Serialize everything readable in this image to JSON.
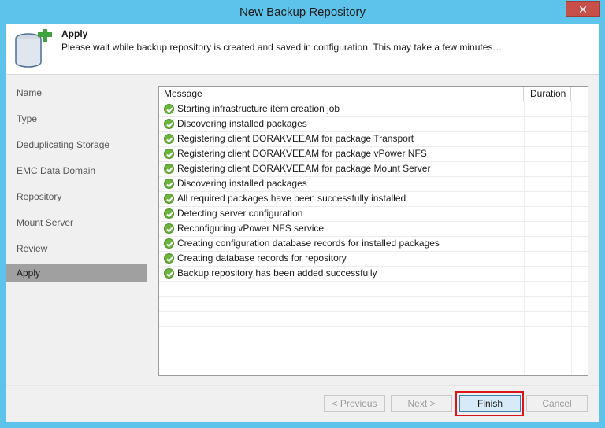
{
  "window": {
    "title": "New Backup Repository",
    "close_label": "✕"
  },
  "header": {
    "title": "Apply",
    "description": "Please wait while backup repository is created and saved in configuration. This may take a few minutes…",
    "icon": "database-add-icon"
  },
  "sidebar": {
    "items": [
      {
        "label": "Name",
        "active": false
      },
      {
        "label": "Type",
        "active": false
      },
      {
        "label": "Deduplicating Storage",
        "active": false
      },
      {
        "label": "EMC Data Domain",
        "active": false
      },
      {
        "label": "Repository",
        "active": false
      },
      {
        "label": "Mount Server",
        "active": false
      },
      {
        "label": "Review",
        "active": false
      },
      {
        "label": "Apply",
        "active": true
      }
    ]
  },
  "log": {
    "columns": [
      "Message",
      "Duration"
    ],
    "rows": [
      {
        "status": "success",
        "message": "Starting infrastructure item creation job",
        "duration": ""
      },
      {
        "status": "success",
        "message": "Discovering installed packages",
        "duration": ""
      },
      {
        "status": "success",
        "message": "Registering client DORAKVEEAM for package Transport",
        "duration": ""
      },
      {
        "status": "success",
        "message": "Registering client DORAKVEEAM for package vPower NFS",
        "duration": ""
      },
      {
        "status": "success",
        "message": "Registering client DORAKVEEAM for package Mount Server",
        "duration": ""
      },
      {
        "status": "success",
        "message": "Discovering installed packages",
        "duration": ""
      },
      {
        "status": "success",
        "message": "All required packages have been successfully installed",
        "duration": ""
      },
      {
        "status": "success",
        "message": "Detecting server configuration",
        "duration": ""
      },
      {
        "status": "success",
        "message": "Reconfiguring vPower NFS service",
        "duration": ""
      },
      {
        "status": "success",
        "message": "Creating configuration database records for installed packages",
        "duration": ""
      },
      {
        "status": "success",
        "message": "Creating database records for repository",
        "duration": ""
      },
      {
        "status": "success",
        "message": "Backup repository has been added successfully",
        "duration": ""
      }
    ]
  },
  "footer": {
    "previous_label": "< Previous",
    "next_label": "Next >",
    "finish_label": "Finish",
    "cancel_label": "Cancel"
  },
  "colors": {
    "titlebar": "#5ec3ea",
    "success": "#6bb33c",
    "highlight": "#d8151a",
    "close": "#c7504b"
  }
}
